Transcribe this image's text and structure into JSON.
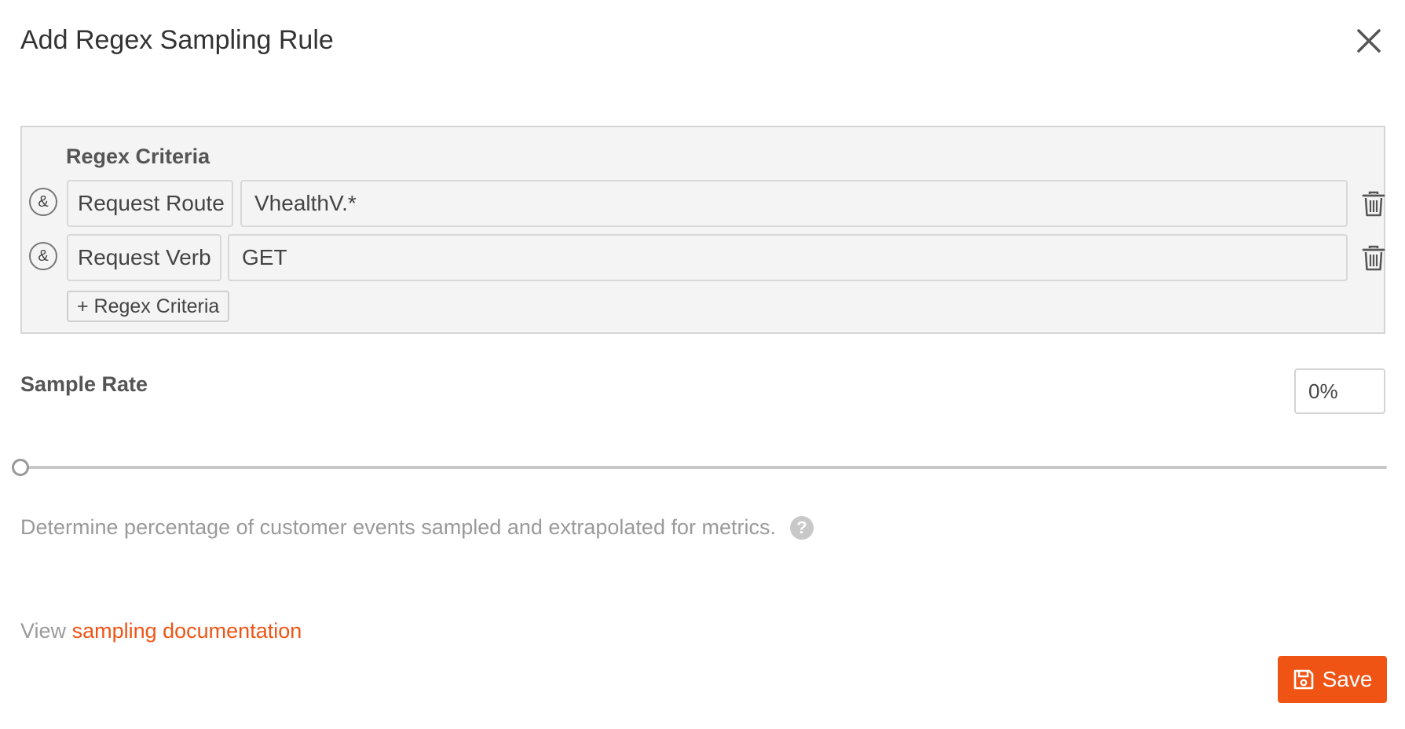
{
  "dialog": {
    "title": "Add Regex Sampling Rule",
    "close_icon": "close-icon"
  },
  "criteria": {
    "heading": "Regex Criteria",
    "rows": [
      {
        "connector": "&",
        "field": "Request Route",
        "value": "VhealthV.*"
      },
      {
        "connector": "&",
        "field": "Request Verb",
        "value": "GET"
      }
    ],
    "delete_icon": "trash-icon",
    "add_label": "+ Regex Criteria"
  },
  "sample_rate": {
    "label": "Sample Rate",
    "value": "0%",
    "slider_percent": 0,
    "helper_text": "Determine percentage of customer events sampled and extrapolated for metrics.",
    "help_icon": "?"
  },
  "docs": {
    "prefix": "View",
    "link_text": "sampling documentation"
  },
  "save": {
    "label": "Save",
    "icon": "floppy-disk-icon"
  },
  "colors": {
    "accent": "#f05415",
    "panel_background": "#f4f4f4"
  }
}
